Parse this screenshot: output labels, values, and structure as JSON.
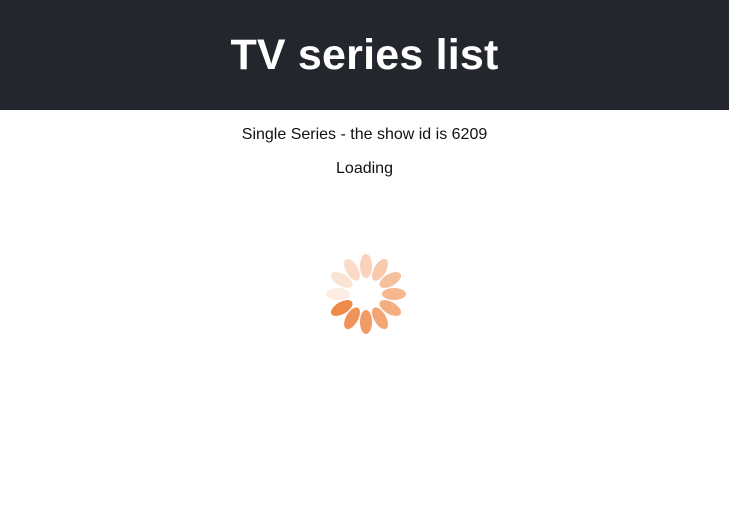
{
  "header": {
    "title": "TV series list"
  },
  "main": {
    "series_line": "Single Series - the show id is 6209",
    "loading_text": "Loading"
  },
  "spinner": {
    "icon": "loading-spinner-icon",
    "color": "#ef8a4a"
  }
}
